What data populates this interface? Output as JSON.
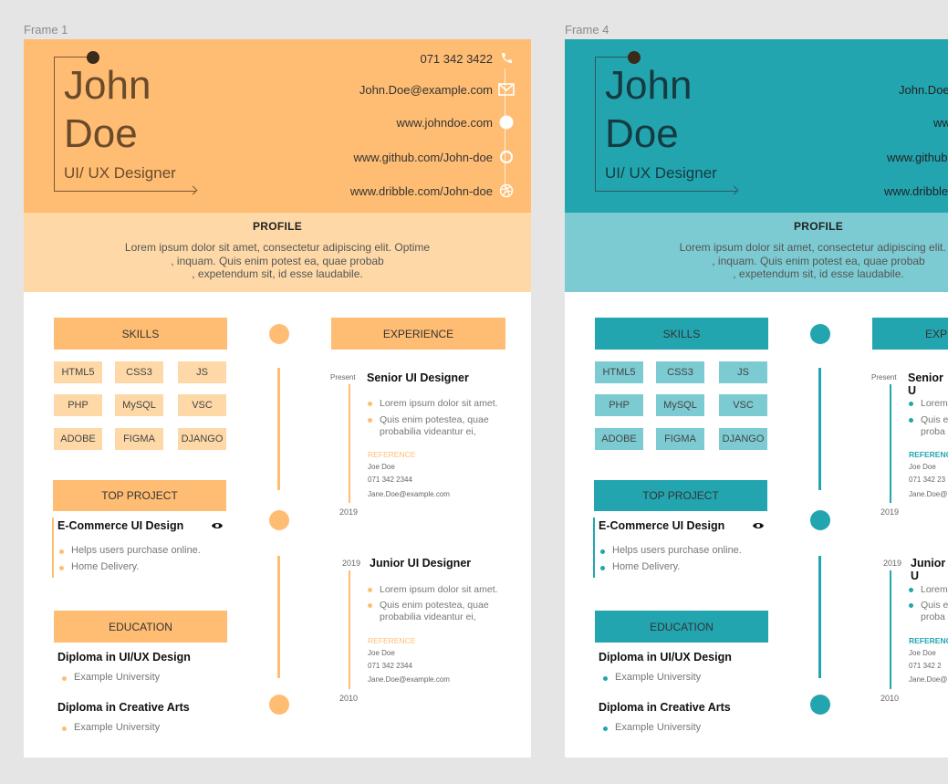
{
  "frames": [
    {
      "label": "Frame 1",
      "header": {
        "first_name": "John",
        "last_name": "Doe",
        "role": "UI/ UX Designer",
        "contacts": [
          {
            "text": "071 342 3422",
            "icon": "phone-icon"
          },
          {
            "text": "John.Doe@example.com",
            "icon": "mail-icon"
          },
          {
            "text": "www.johndoe.com",
            "icon": "globe-icon"
          },
          {
            "text": "www.github.com/John-doe",
            "icon": "github-icon"
          },
          {
            "text": "www.dribble.com/John-doe",
            "icon": "dribbble-icon"
          }
        ]
      },
      "profile": {
        "title": "PROFILE",
        "text": "Lorem ipsum dolor sit amet, consectetur adipiscing elit. Optime\n, inquam. Quis enim potest ea, quae probab\n, expetendum sit, id esse laudabile."
      },
      "skills": {
        "title": "SKILLS",
        "items": [
          "HTML5",
          "CSS3",
          "JS",
          "PHP",
          "MySQL",
          "VSC",
          "ADOBE",
          "FIGMA",
          "DJANGO"
        ]
      },
      "top_project": {
        "title": "TOP PROJECT",
        "name": "E-Commerce UI Design",
        "bullets": [
          "Helps users purchase online.",
          "Home Delivery."
        ]
      },
      "education": {
        "title": "EDUCATION",
        "items": [
          {
            "degree": "Diploma in UI/UX Design",
            "school": "Example University"
          },
          {
            "degree": "Diploma in Creative Arts",
            "school": "Example University"
          }
        ]
      },
      "experience": {
        "title": "EXPERIENCE",
        "jobs": [
          {
            "start": "Present",
            "end": "2019",
            "title": "Senior UI Designer",
            "bullets": [
              "Lorem ipsum dolor sit amet.",
              "Quis enim potestea, quae probabilia videantur ei,"
            ],
            "reference_label": "REFERENCE",
            "reference": [
              "Joe Doe",
              "071 342 2344",
              "Jane.Doe@example.com"
            ]
          },
          {
            "start": "2019",
            "end": "2010",
            "title": "Junior UI Designer",
            "bullets": [
              "Lorem ipsum dolor sit amet.",
              "Quis enim potestea, quae probabilia videantur ei,"
            ],
            "reference_label": "REFERENCE",
            "reference": [
              "Joe Doe",
              "071 342 2344",
              "Jane.Doe@example.com"
            ]
          }
        ]
      },
      "colors": {
        "accent": "#ffbd73",
        "accent_light": "#fed9a7"
      }
    },
    {
      "label": "Frame 4",
      "header": {
        "first_name": "John",
        "last_name": "Doe",
        "role": "UI/ UX Designer",
        "contacts": [
          {
            "text": "John.Doe",
            "icon": "mail-icon"
          },
          {
            "text": "ww",
            "icon": "globe-icon"
          },
          {
            "text": "www.github",
            "icon": "github-icon"
          },
          {
            "text": "www.dribble",
            "icon": "dribbble-icon"
          }
        ]
      },
      "profile": {
        "title": "PROFILE",
        "text": "Lorem ipsum dolor sit amet, consectetur adipiscing elit. O\n, inquam. Quis enim potest ea, quae probab\n, expetendum sit, id esse laudabile."
      },
      "skills": {
        "title": "SKILLS",
        "items": [
          "HTML5",
          "CSS3",
          "JS",
          "PHP",
          "MySQL",
          "VSC",
          "ADOBE",
          "FIGMA",
          "DJANGO"
        ]
      },
      "top_project": {
        "title": "TOP PROJECT",
        "name": "E-Commerce UI Design",
        "bullets": [
          "Helps users purchase online.",
          "Home Delivery."
        ]
      },
      "education": {
        "title": "EDUCATION",
        "items": [
          {
            "degree": "Diploma in UI/UX Design",
            "school": "Example University"
          },
          {
            "degree": "Diploma in Creative Arts",
            "school": "Example University"
          }
        ]
      },
      "experience": {
        "title": "EXPER",
        "jobs": [
          {
            "start": "Present",
            "end": "2019",
            "title": "Senior U",
            "bullets": [
              "Lorem",
              "Quis e\nproba"
            ],
            "reference_label": "REFERENC",
            "reference": [
              "Joe Doe",
              "071 342 23",
              "Jane.Doe@"
            ]
          },
          {
            "start": "2019",
            "end": "2010",
            "title": "Junior U",
            "bullets": [
              "Lorem",
              "Quis e\nproba"
            ],
            "reference_label": "REFERENC",
            "reference": [
              "Joe Doe",
              "071 342 2",
              "Jane.Doe@"
            ]
          }
        ]
      },
      "colors": {
        "accent": "#23a5b0",
        "accent_light": "#7ccbd2"
      }
    }
  ]
}
